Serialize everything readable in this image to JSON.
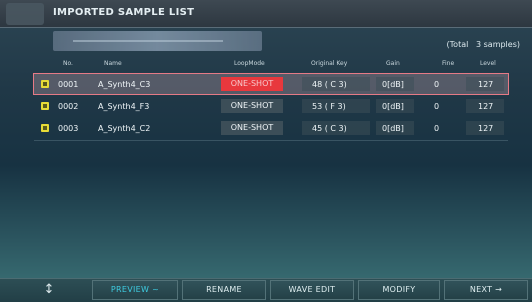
{
  "window": {
    "title": "IMPORTED SAMPLE LIST"
  },
  "summary": {
    "total_label": "(Total",
    "total_value": "3 samples)"
  },
  "columns": {
    "no": "No.",
    "name": "Name",
    "loop_mode": "LoopMode",
    "original_key": "Original Key",
    "gain": "Gain",
    "fine": "Fine",
    "level": "Level"
  },
  "rows": [
    {
      "no": "0001",
      "name": "A_Synth4_C3",
      "loop_mode": "ONE-SHOT",
      "original_key": "48 ( C 3)",
      "gain": "0[dB]",
      "fine": "0",
      "level": "127",
      "selected": true
    },
    {
      "no": "0002",
      "name": "A_Synth4_F3",
      "loop_mode": "ONE-SHOT",
      "original_key": "53 ( F 3)",
      "gain": "0[dB]",
      "fine": "0",
      "level": "127",
      "selected": false
    },
    {
      "no": "0003",
      "name": "A_Synth4_C2",
      "loop_mode": "ONE-SHOT",
      "original_key": "45 ( C 3)",
      "gain": "0[dB]",
      "fine": "0",
      "level": "127",
      "selected": false
    }
  ],
  "toolbar": {
    "updown_glyph": "↕",
    "preview": "PREVIEW ~",
    "rename": "RENAME",
    "wave_edit": "WAVE EDIT",
    "modify": "MODIFY",
    "next": "NEXT →"
  },
  "colors": {
    "selected_outline": "#e67a86",
    "loop_highlight": "#e8383d",
    "sample_marker": "#e8dc37",
    "preview_active": "#3ecbe0"
  }
}
